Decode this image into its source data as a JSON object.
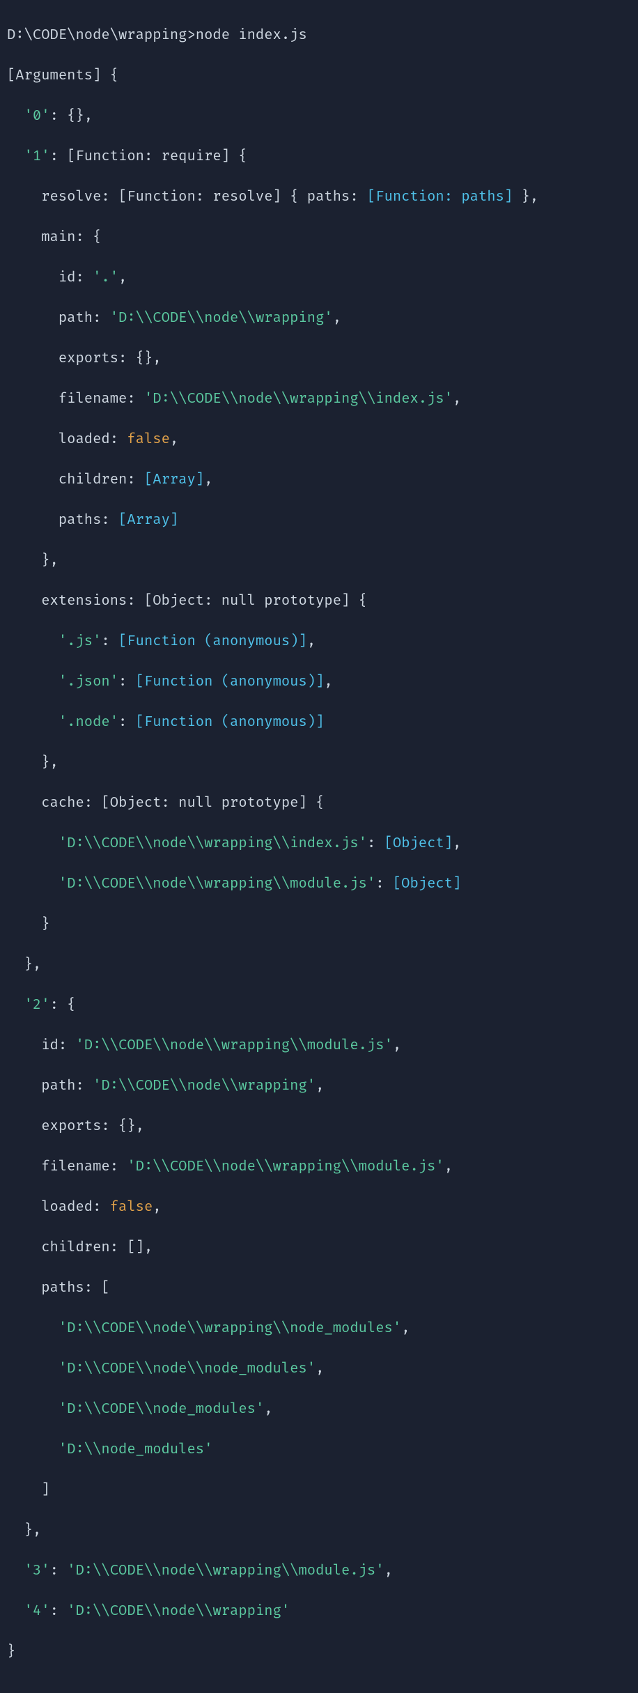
{
  "prompt": "D:\\CODE\\node\\wrapping>node index.js",
  "header": "[Arguments] {",
  "k0": "'0'",
  "v0_braces": ": {},",
  "k1": "'1'",
  "k1_head": ": [Function: require] {",
  "resolve_key": "resolve",
  "resolve_head": ": [Function: resolve] { ",
  "resolve_paths_key": "paths",
  "resolve_paths_sep": ": ",
  "resolve_paths_val": "[Function: paths]",
  "resolve_tail": " },",
  "main_key": "main",
  "main_head": ": {",
  "id_key": "id",
  "id_sep": ": ",
  "id_val": "'.'",
  "path_key": "path",
  "path_sep": ": ",
  "path_val": "'D:\\\\CODE\\\\node\\\\wrapping'",
  "exports_key": "exports",
  "exports_val": ": {},",
  "filename_key": "filename",
  "filename_sep": ": ",
  "filename_val": "'D:\\\\CODE\\\\node\\\\wrapping\\\\index.js'",
  "loaded_key": "loaded",
  "loaded_sep": ": ",
  "loaded_val": "false",
  "children_key": "children",
  "children_sep": ": ",
  "children_val": "[Array]",
  "paths_key": "paths",
  "paths_sep": ": ",
  "paths_val": "[Array]",
  "close_brace_comma": "},",
  "extensions_key": "extensions",
  "extensions_head": ": [Object: null prototype] {",
  "ext_js_key": "'.js'",
  "ext_anon_sep": ": ",
  "ext_anon_val": "[Function (anonymous)]",
  "ext_json_key": "'.json'",
  "ext_node_key": "'.node'",
  "cache_key": "cache",
  "cache_head": ": [Object: null prototype] {",
  "cache1_key": "'D:\\\\CODE\\\\node\\\\wrapping\\\\index.js'",
  "cache_obj_val": "[Object]",
  "cache2_key": "'D:\\\\CODE\\\\node\\\\wrapping\\\\module.js'",
  "close_brace": "}",
  "k2": "'2'",
  "k2_head": ": {",
  "m2_id_key": "id",
  "m2_id_val": "'D:\\\\CODE\\\\node\\\\wrapping\\\\module.js'",
  "m2_path_key": "path",
  "m2_path_val": "'D:\\\\CODE\\\\node\\\\wrapping'",
  "m2_exports_key": "exports",
  "m2_filename_key": "filename",
  "m2_filename_val": "'D:\\\\CODE\\\\node\\\\wrapping\\\\module.js'",
  "m2_loaded_key": "loaded",
  "m2_children_key": "children",
  "m2_children_val": ": [],",
  "m2_paths_key": "paths",
  "m2_paths_head": ": [",
  "m2_paths_0": "'D:\\\\CODE\\\\node\\\\wrapping\\\\node_modules'",
  "m2_paths_1": "'D:\\\\CODE\\\\node\\\\node_modules'",
  "m2_paths_2": "'D:\\\\CODE\\\\node_modules'",
  "m2_paths_3": "'D:\\\\node_modules'",
  "close_bracket": "]",
  "k3": "'3'",
  "k3_val": "'D:\\\\CODE\\\\node\\\\wrapping\\\\module.js'",
  "k4": "'4'",
  "k4_val": "'D:\\\\CODE\\\\node\\\\wrapping'",
  "comma": ",",
  "colon_space": ": "
}
